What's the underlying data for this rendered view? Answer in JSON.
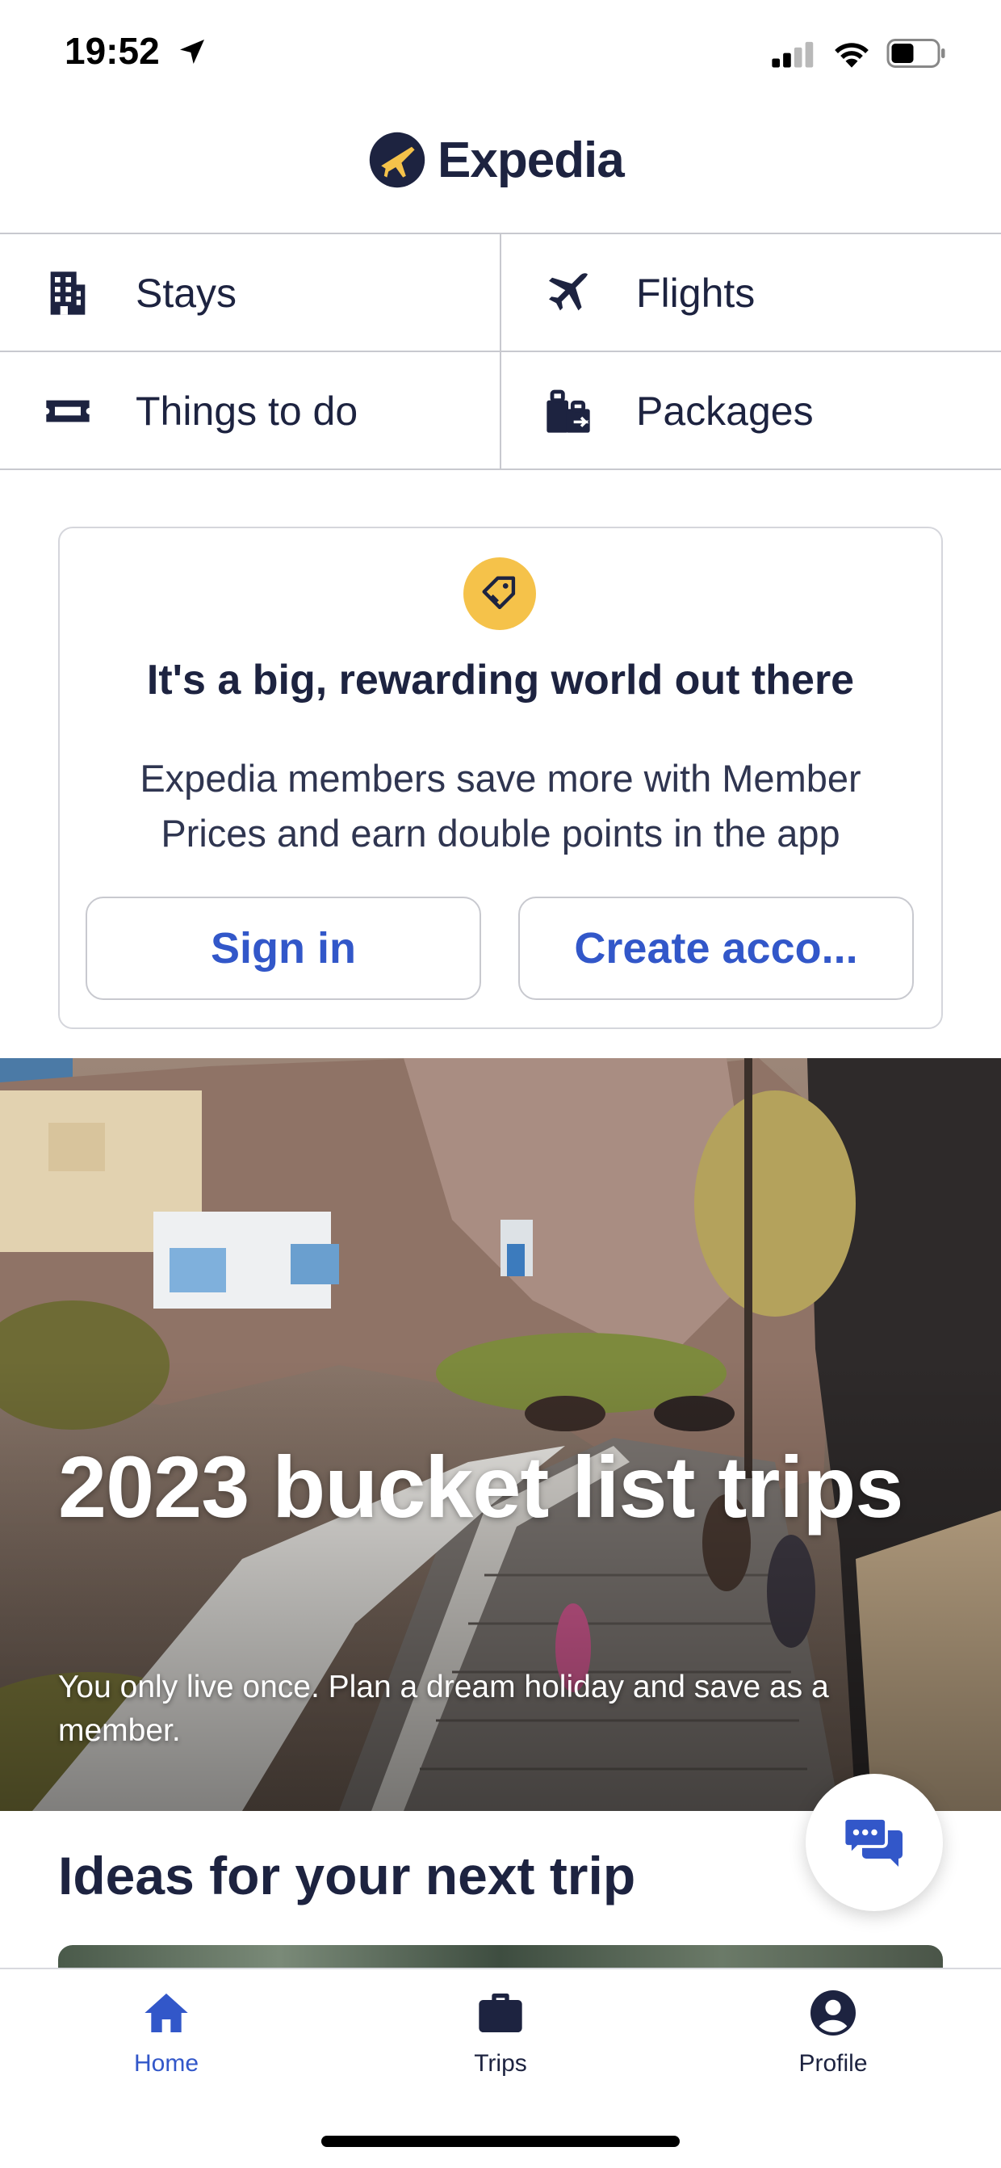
{
  "status_bar": {
    "time": "19:52",
    "icons": [
      "location-arrow-icon",
      "cellular-signal-icon",
      "wifi-icon",
      "battery-icon"
    ]
  },
  "header": {
    "logo_text": "Expedia"
  },
  "nav": {
    "stays": "Stays",
    "flights": "Flights",
    "things_to_do": "Things to do",
    "packages": "Packages"
  },
  "rewards_card": {
    "title": "It's a big, rewarding world out there",
    "body": "Expedia members save more with Member Prices and earn double points in the app",
    "sign_in_label": "Sign in",
    "create_account_label": "Create acco..."
  },
  "hero": {
    "title": "2023 bucket list trips",
    "subtitle": "You only live once. Plan a dream holiday and save as a member."
  },
  "ideas": {
    "title": "Ideas for your next trip"
  },
  "tabbar": {
    "home": "Home",
    "trips": "Trips",
    "profile": "Profile"
  },
  "colors": {
    "brand_navy": "#1d2340",
    "accent_blue": "#3257c9",
    "logo_yellow": "#f5c24a",
    "divider": "#c8c9cf"
  }
}
